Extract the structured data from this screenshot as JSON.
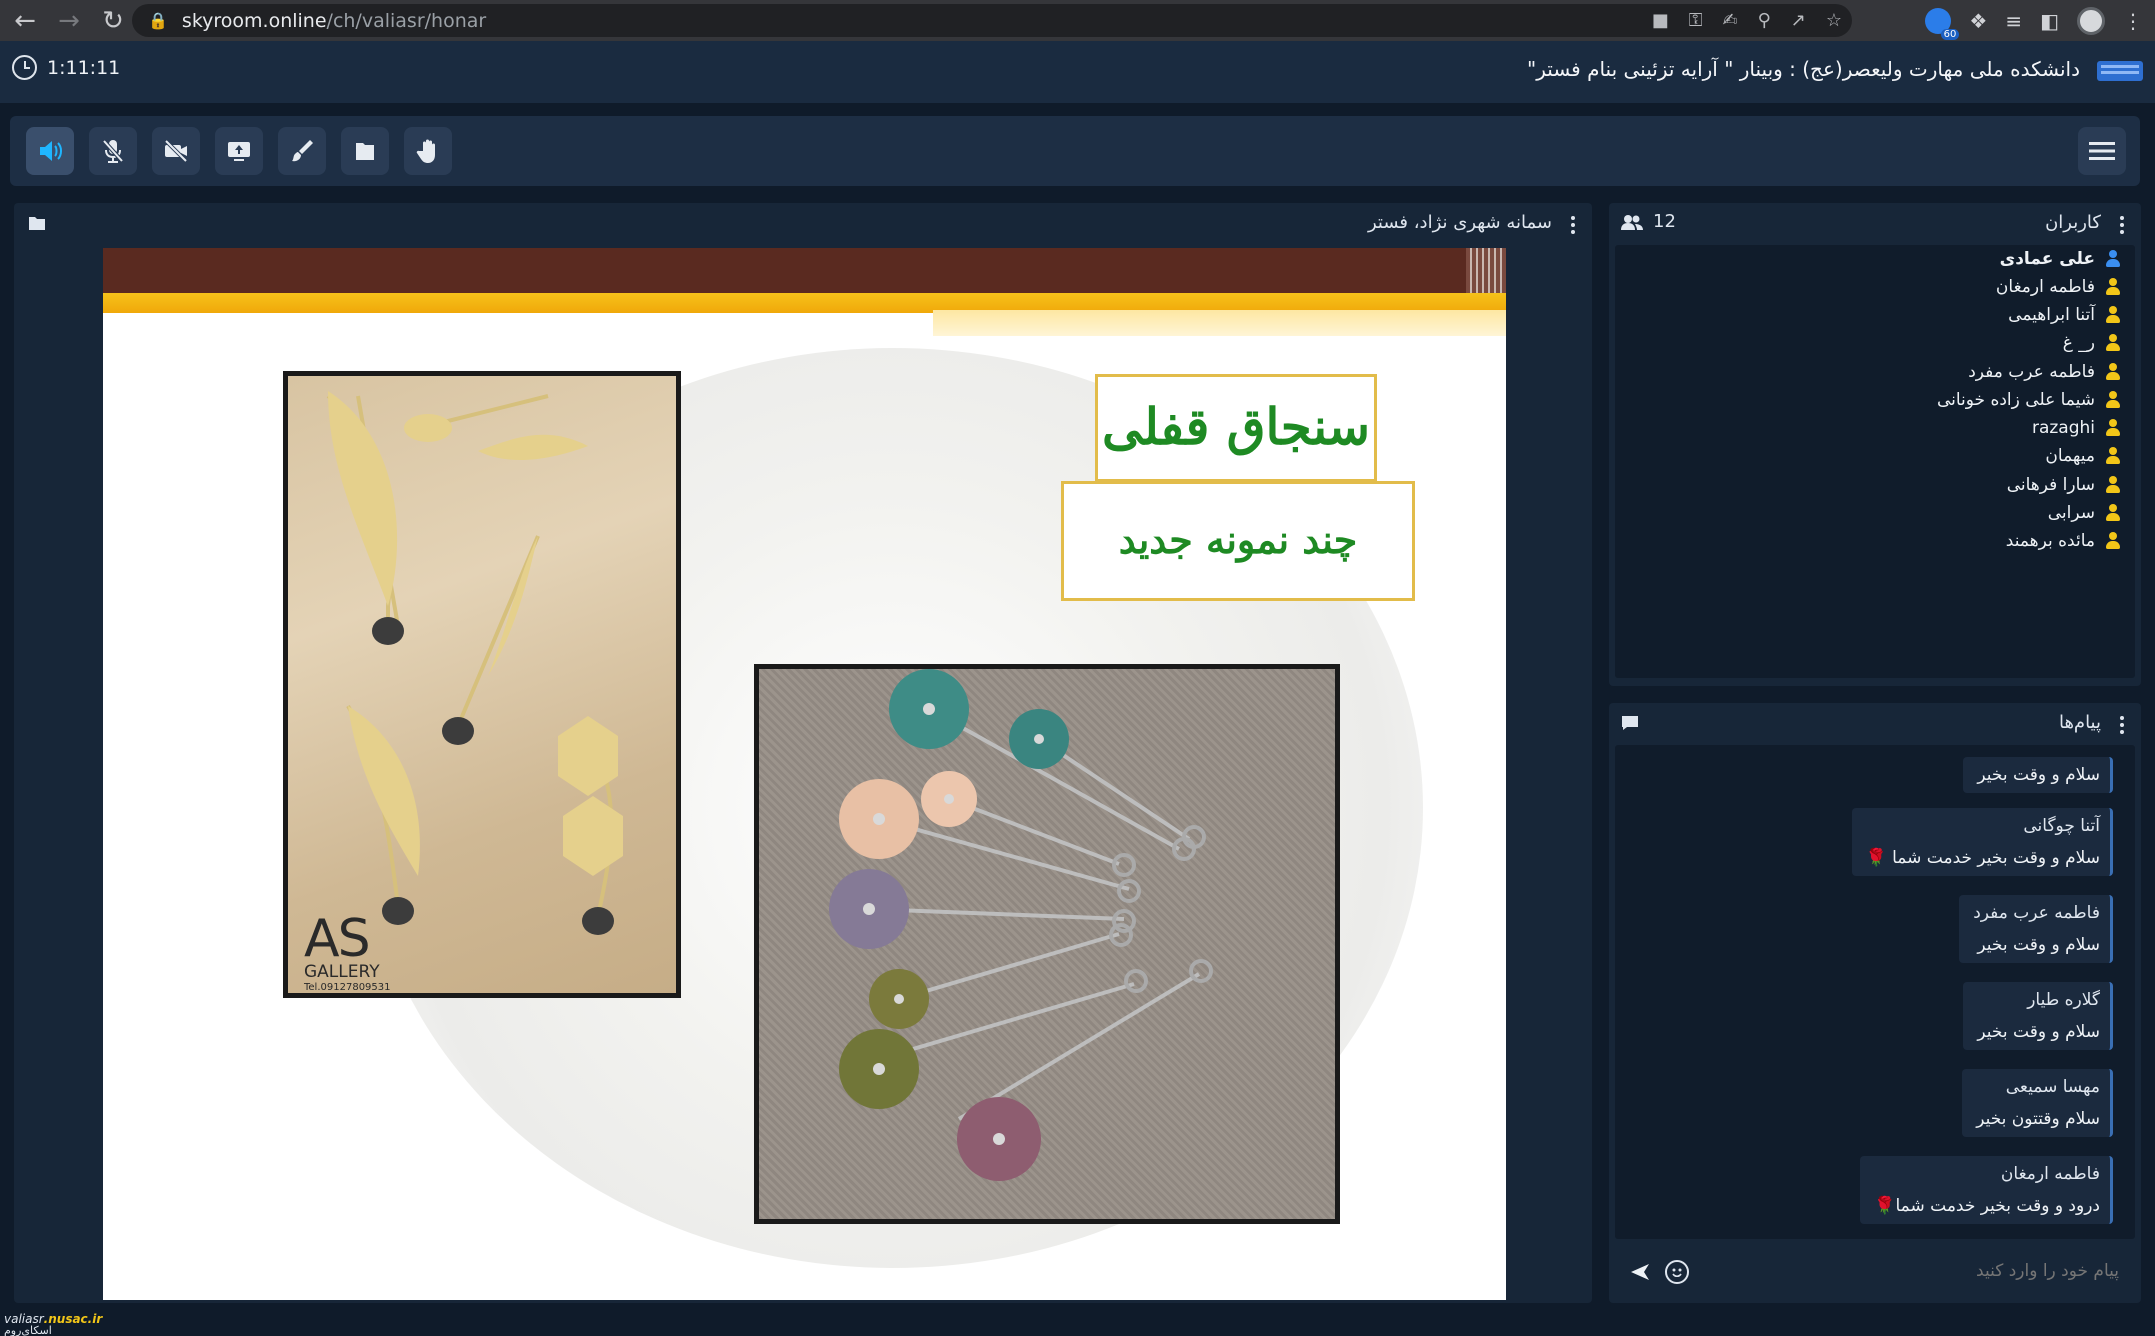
{
  "browser": {
    "url_host": "skyroom.online",
    "url_path": "/ch/valiasr/honar",
    "extension_badge": "60"
  },
  "header": {
    "timer": "1:11:11",
    "room_title": "دانشکده ملی مهارت ولیعصر(عج) : وبینار \" آرایه تزئینی بنام فستر\""
  },
  "presentation": {
    "presenter_label": "سمانه شهری نژاد، فستر",
    "slide": {
      "title": "سنجاق قفلی",
      "subtitle": "چند نمونه جدید",
      "gallery_logo": "AS",
      "gallery_word": "GALLERY",
      "gallery_tel": "Tel.09127809531"
    }
  },
  "users": {
    "title": "کاربران",
    "count": "12",
    "items": [
      {
        "name": "علی عمادی",
        "me": true
      },
      {
        "name": "فاطمه ارمغان",
        "me": false
      },
      {
        "name": "آتنا ابراهیمی",
        "me": false
      },
      {
        "name": "ر_ غ",
        "me": false
      },
      {
        "name": "فاطمه عرب مفرد",
        "me": false
      },
      {
        "name": "شیما علی زاده خونانی",
        "me": false
      },
      {
        "name": "razaghi",
        "me": false
      },
      {
        "name": "میهمان",
        "me": false
      },
      {
        "name": "سارا فرهانی",
        "me": false
      },
      {
        "name": "سرابی",
        "me": false
      },
      {
        "name": "مائده برهمند",
        "me": false
      }
    ]
  },
  "messages": {
    "title": "پیام‌ها",
    "items": [
      {
        "sender": "",
        "text": "سلام و وقت بخیر"
      },
      {
        "sender": "آتنا چوگانی",
        "text": "سلام و وقت بخیر خدمت شما 🌹"
      },
      {
        "sender": "فاطمه عرب مفرد",
        "text": "سلام و وقت بخیر"
      },
      {
        "sender": "گلاره طیار",
        "text": "سلام و وقت بخیر"
      },
      {
        "sender": "مهسا سمیعی",
        "text": "سلام وقتتون بخیر"
      },
      {
        "sender": "فاطمه ارمغان",
        "text": "درود و وقت بخیر خدمت شما🌹"
      }
    ],
    "input_placeholder": "پیام خود را وارد کنید"
  },
  "footer": {
    "brand_prefix": "valiasr",
    "brand_domain": ".nusac.ir",
    "brand_sub": "اسکای‌روم"
  },
  "colors": {
    "accent_active": "#1fb6ff",
    "user_icon": "#f2c618",
    "self_user_icon": "#3a8ef0",
    "slide_title_green": "#1e8a23"
  },
  "icons": {
    "toolbar": [
      "speaker-icon",
      "mic-off-icon",
      "camera-off-icon",
      "screen-share-icon",
      "whiteboard-brush-icon",
      "file-icon",
      "raise-hand-icon"
    ]
  }
}
